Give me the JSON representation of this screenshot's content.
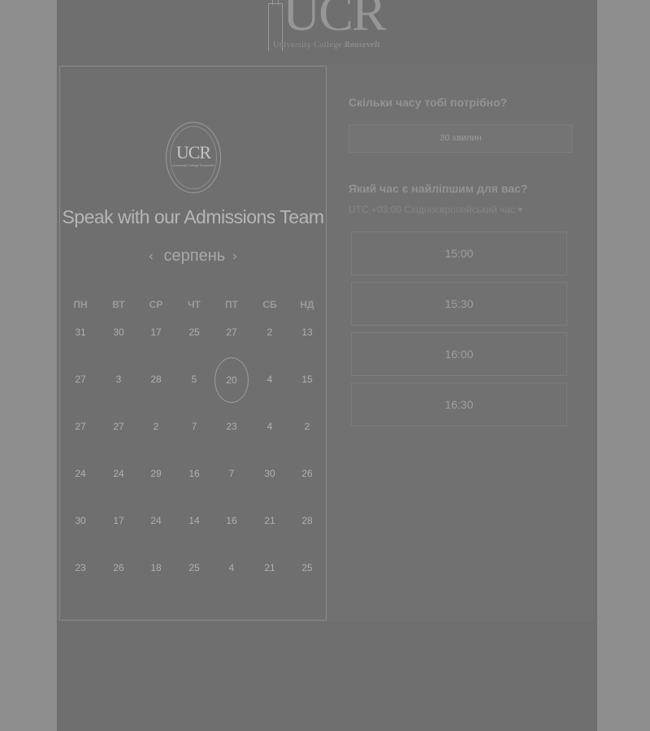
{
  "brand": {
    "logo_text": "UCR",
    "tagline_plain": "University College",
    "tagline_bold": "Roosevelt"
  },
  "calendar": {
    "logo_text": "UCR",
    "title": "Speak with our Admissions Team",
    "month": "серпень",
    "weekdays": [
      "ПН",
      "ВТ",
      "СР",
      "ЧТ",
      "ПТ",
      "СБ",
      "НД"
    ],
    "weeks": [
      [
        "31",
        "30",
        "17",
        "25",
        "27",
        "2",
        "13"
      ],
      [
        "27",
        "3",
        "28",
        "5",
        "20",
        "4",
        "15"
      ],
      [
        "27",
        "27",
        "2",
        "7",
        "23",
        "4",
        "2"
      ],
      [
        "24",
        "24",
        "29",
        "16",
        "7",
        "30",
        "26"
      ],
      [
        "30",
        "17",
        "24",
        "14",
        "16",
        "21",
        "28"
      ],
      [
        "23",
        "26",
        "18",
        "25",
        "4",
        "21",
        "25"
      ]
    ],
    "selected": "20"
  },
  "booking": {
    "duration_question": "Скільки часу тобі потрібно?",
    "duration_value": "30 хвилин",
    "time_question": "Який час є найліпшим для вас?",
    "timezone": "UTC +03:00 Східноєвропейський час ▾",
    "slots": [
      "15:00",
      "15:30",
      "16:00",
      "16:30"
    ]
  }
}
